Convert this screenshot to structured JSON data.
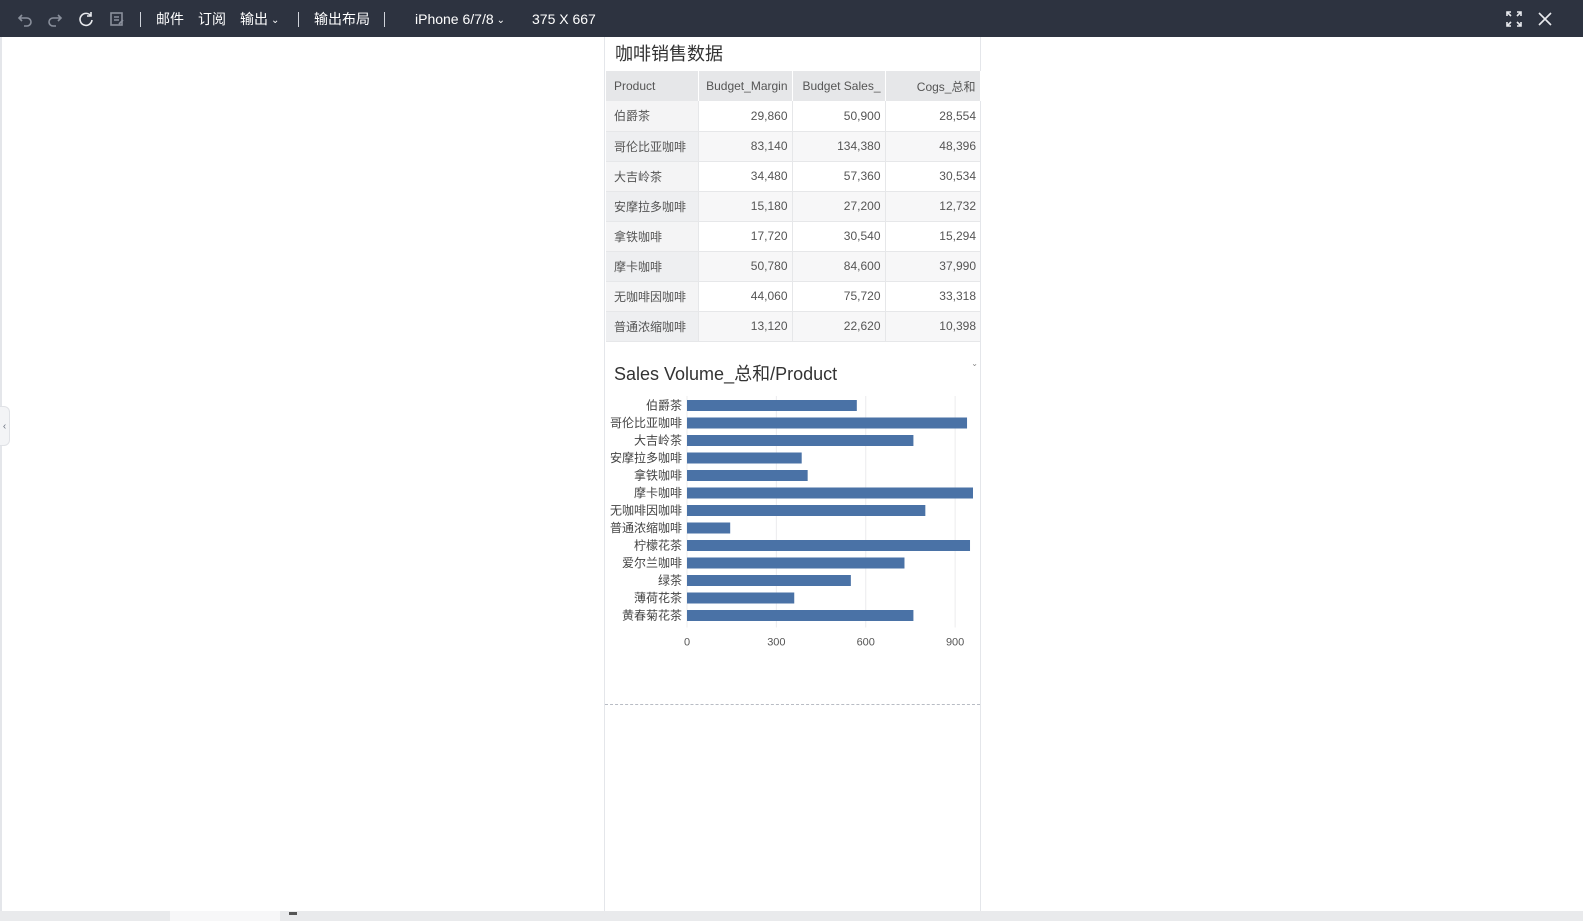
{
  "toolbar": {
    "icons": [
      "undo-icon",
      "redo-icon",
      "refresh-icon",
      "save-icon",
      "fullscreen-icon",
      "close-icon"
    ],
    "mail": "邮件",
    "subscribe": "订阅",
    "export": "输出",
    "export_layout": "输出布局",
    "device": "iPhone 6/7/8",
    "resolution": "375 X 667"
  },
  "report": {
    "title": "咖啡销售数据",
    "table": {
      "columns": [
        "Product",
        "Budget_Margin",
        "Budget Sales_",
        "Cogs_总和"
      ],
      "rows": [
        [
          "伯爵茶",
          "29,860",
          "50,900",
          "28,554"
        ],
        [
          "哥伦比亚咖啡",
          "83,140",
          "134,380",
          "48,396"
        ],
        [
          "大吉岭茶",
          "34,480",
          "57,360",
          "30,534"
        ],
        [
          "安摩拉多咖啡",
          "15,180",
          "27,200",
          "12,732"
        ],
        [
          "拿铁咖啡",
          "17,720",
          "30,540",
          "15,294"
        ],
        [
          "摩卡咖啡",
          "50,780",
          "84,600",
          "37,990"
        ],
        [
          "无咖啡因咖啡",
          "44,060",
          "75,720",
          "33,318"
        ],
        [
          "普通浓缩咖啡",
          "13,120",
          "22,620",
          "10,398"
        ]
      ]
    }
  },
  "chart_data": {
    "type": "bar",
    "orientation": "horizontal",
    "title": "Sales Volume_总和/Product",
    "categories": [
      "伯爵茶",
      "哥伦比亚咖啡",
      "大吉岭茶",
      "安摩拉多咖啡",
      "拿铁咖啡",
      "摩卡咖啡",
      "无咖啡因咖啡",
      "普通浓缩咖啡",
      "柠檬花茶",
      "爱尔兰咖啡",
      "绿茶",
      "薄荷花茶",
      "黄春菊花茶"
    ],
    "values": [
      570,
      940,
      760,
      385,
      405,
      960,
      800,
      145,
      950,
      730,
      550,
      360,
      760
    ],
    "xticks": [
      0,
      300,
      600,
      900
    ],
    "xlim": [
      0,
      960
    ],
    "xlabel": "",
    "ylabel": "",
    "bar_color": "#4a72a6",
    "grid": true
  }
}
